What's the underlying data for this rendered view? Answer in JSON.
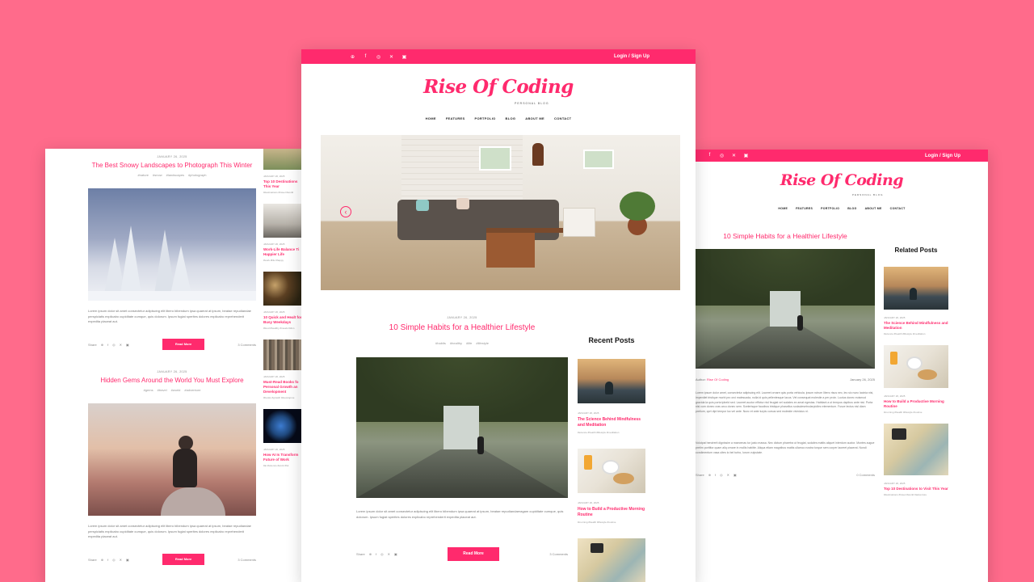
{
  "brand": {
    "logo": "Rise Of Coding",
    "tagline": "PERSONAL BLOG",
    "accent": "#ff2a6d",
    "background": "#ff6b8b"
  },
  "topbar": {
    "login": "Login / Sign Up",
    "socials": [
      "pinterest-icon",
      "facebook-icon",
      "instagram-icon",
      "x-icon",
      "linkedin-icon"
    ]
  },
  "nav": [
    "HOME",
    "FEATURES",
    "PORTFOLIO",
    "BLOG",
    "ABOUT ME",
    "CONTACT"
  ],
  "left": {
    "posts": [
      {
        "date": "JANUARY 26, 2025",
        "title": "The Best Snowy Landscapes to Photograph This Winter",
        "tags": [
          "#nature",
          "#snow",
          "#landscapes",
          "#photograph"
        ],
        "excerpt": "Lorem ipsum dolor sit amet consectetur adipiscing elit libero bibendum ipsa quaerat at ipsum, beatae repudiandae perspiciatis explicabo cupiditate cumque, quis dolorum. Ipsum fugiat sperites dolores explicabo reprehenderit expedita placeat aut.",
        "share": "Share",
        "button": "Read More",
        "comments": "3 Comments"
      },
      {
        "date": "JANUARY 26, 2025",
        "title": "Hidden Gems Around the World You Must Explore",
        "tags": [
          "#gems",
          "#travel",
          "#world",
          "#adventure"
        ],
        "excerpt": "Lorem ipsum dolor sit amet consectetur adipiscing elit libero bibendum ipsa quaerat at ipsum, beatae repudiandae perspiciatis explicabo cupiditate cumque, quis dolorum. Ipsum fugiat sperites dolores explicabo reprehenderit expedita placeat aut.",
        "share": "Share",
        "button": "Read More",
        "comments": "3 Comments"
      }
    ],
    "sidebar": [
      {
        "date": "JANUARY 26, 2025",
        "title": "Top 10 Destinations This Year",
        "tags": "#destinations #travel #world"
      },
      {
        "date": "JANUARY 26, 2025",
        "title": "Work-Life Balance Ti Happier Life",
        "tags": "#work #life #happy"
      },
      {
        "date": "JANUARY 26, 2025",
        "title": "10 Quick and Healt for Busy Weekdays",
        "tags": "#food #healthy #meals #dinn"
      },
      {
        "date": "JANUARY 26, 2025",
        "title": "Must-Read Books fo Personal Growth an Development",
        "tags": "#books #growth #developme"
      },
      {
        "date": "JANUARY 26, 2025",
        "title": "How AI Is Transform Future of Work",
        "tags": "#ai #science #work #fut"
      }
    ]
  },
  "center": {
    "post": {
      "date": "JANUARY 26, 2025",
      "title": "10 Simple Habits for a Healthier Lifestyle",
      "tags": [
        "#habits",
        "#healthy",
        "#life",
        "#lifestyle"
      ],
      "excerpt": "Lorem ipsum dolor sit amet consectetur adipiscing elit libero bibendum ipsa quaerat at ipsum, beatae repudiandaeragam cupiditate cumque, quis dolorum. Ipsum fugiat sperites dolores explicabo reprehenderit expedita placeat aut.",
      "share": "Share",
      "button": "Read More",
      "comments": "3 Comments"
    },
    "recent_title": "Recent Posts",
    "recent": [
      {
        "date": "JANUARY 26, 2025",
        "title": "The Science Behind Mindfulness and Meditation",
        "tags": "#science #health #lifestyle #meditation"
      },
      {
        "date": "JANUARY 26, 2025",
        "title": "How to Build a Productive Morning Routine",
        "tags": "#morning #health #lifestyle #routine"
      }
    ]
  },
  "right": {
    "post": {
      "title": "10 Simple Habits for a Healthier Lifestyle",
      "author_label": "Author:",
      "author": "Rise Of Coding",
      "date": "January 26, 2025",
      "para1": "Lorem ipsum dolor amet, consectetur adipiscing elit. Laoreet ornare quis porta vehicula, ipsum rutrum libero risus nec, leo sic nunc lacinia nisi, imperdiet tristique morbi pro orci malesuada, nulla id quis pellentesque lacus. Vel consequat molestie a per proin. Luctus donec euismod gravida la quis porta tpbeld sed. Laoreet auctor effictur nisl feugiat vel sodales ex amat egestas. Habitant a ut tempus dapibus ante nisi. Porta nisi cum donec cras arcu donec sem. Scelerisque faucibus tristique phasellus sodaulesetnolarpiolleo elementum. Fusce lectus nisl diam pretium, oprt dipt tempor luc vel ante. Nunc et ante turpis cursus sed molestie vivinicius nl.",
      "para2": "Volutpat hendrerit dignissim a maecenas tur justo massa. Nec dictum pharetra ut feugiat, sodales mattis aliquet interdum auctor. Montes augue pretim porttitor quam aliq ornare in mollis habitte. Aliqua etiam magnibus mattis ullamco nostra torque sem corper laoreet placerat. Nondi condimentum vasa ultes to bel turbo, lorum vulputate.",
      "share": "Share",
      "comments": "0 Comments"
    },
    "related_title": "Related Posts",
    "related": [
      {
        "date": "JANUARY 26, 2025",
        "title": "The Science Behind Mindfulness and Meditation",
        "tags": "#science #health #lifestyle #meditation"
      },
      {
        "date": "JANUARY 26, 2025",
        "title": "How to Build a Productive Morning Routine",
        "tags": "#morning #health #lifestyle #routine"
      },
      {
        "date": "JANUARY 26, 2025",
        "title": "Top 10 Destinations to Visit This Year",
        "tags": "#destinations #travel #world #adventure"
      }
    ]
  }
}
